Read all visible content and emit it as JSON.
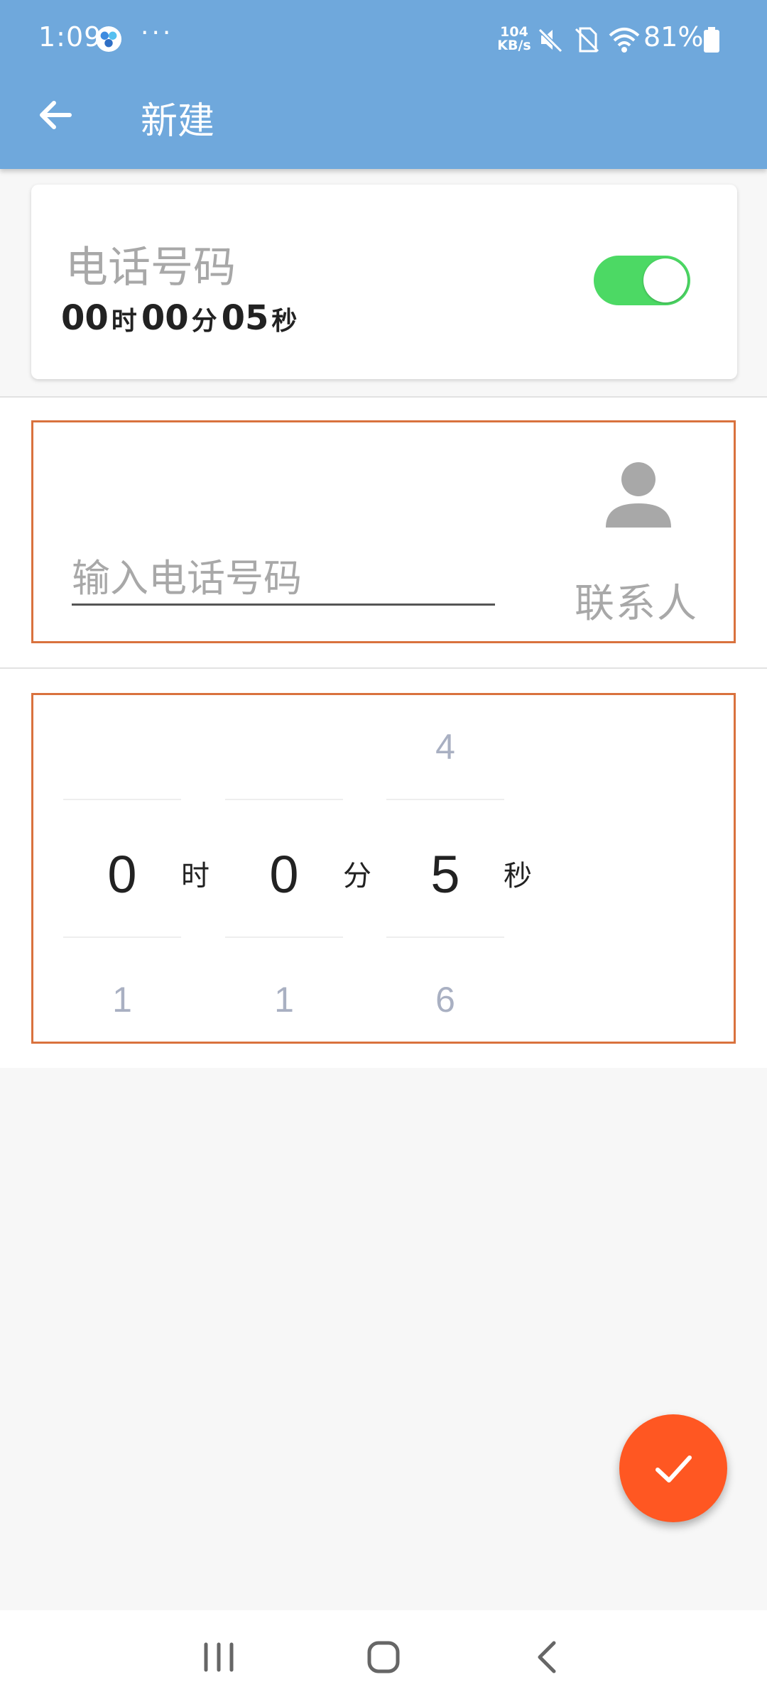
{
  "status_bar": {
    "time": "1:09",
    "more": "···",
    "net_speed_value": "104",
    "net_speed_unit": "KB/s",
    "battery_percent": "81%"
  },
  "app_bar": {
    "title": "新建"
  },
  "summary": {
    "name": "电话号码",
    "hours": "00",
    "hours_unit": "时",
    "minutes": "00",
    "minutes_unit": "分",
    "seconds": "05",
    "seconds_unit": "秒",
    "enabled": true
  },
  "phone": {
    "placeholder": "输入电话号码",
    "value": "",
    "contact_label": "联系人"
  },
  "picker": {
    "hours": {
      "prev": "",
      "current": "0",
      "next": "1",
      "unit": "时"
    },
    "minutes": {
      "prev": "",
      "current": "0",
      "next": "1",
      "unit": "分"
    },
    "seconds": {
      "prev": "4",
      "current": "5",
      "next": "6",
      "unit": "秒"
    }
  },
  "icons": {
    "back": "arrow-left-icon",
    "contact": "person-icon",
    "confirm": "check-icon",
    "nav_recents": "recents-icon",
    "nav_home": "home-icon",
    "nav_back": "nav-back-icon"
  },
  "colors": {
    "app_bar": "#6fa8dc",
    "toggle_on": "#4cd964",
    "box_border": "#d9723e",
    "fab": "#ff5722"
  }
}
